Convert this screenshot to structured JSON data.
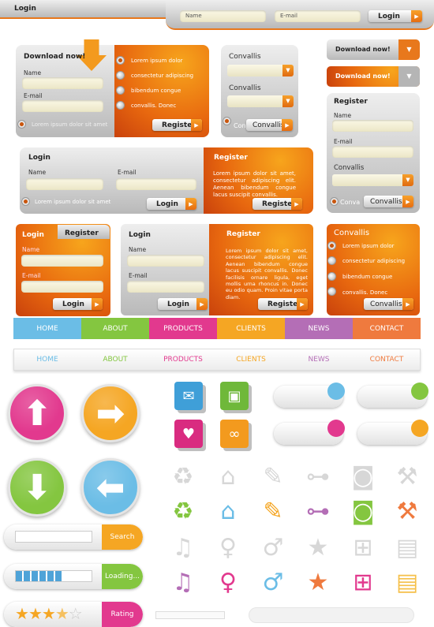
{
  "top_bar": {
    "title": "Login",
    "name_placeholder": "Name",
    "email_placeholder": "E-mail",
    "login_label": "Login"
  },
  "panel_download": {
    "title": "Download now!",
    "name_label": "Name",
    "email_label": "E-mail",
    "remember": "Lorem ipsum dolor sit amet",
    "options": [
      "Lorem   ipsum   dolor",
      "consectetur adipiscing",
      "bibendum  congue",
      "convallis.  Donec"
    ],
    "register_label": "Register"
  },
  "panel_convallis": {
    "label1": "Convallis",
    "label2": "Convallis",
    "radio_label": "Conva",
    "button_label": "Convallis"
  },
  "download_buttons": {
    "gray": "Download now!",
    "orange": "Download now!"
  },
  "panel_register_right": {
    "title": "Register",
    "name_label": "Name",
    "email_label": "E-mail",
    "select_label": "Convallis",
    "radio_label": "Conva",
    "button_label": "Convallis"
  },
  "panel_login_wide": {
    "title": "Login",
    "name_label": "Name",
    "email_label": "E-mail",
    "remember": "Lorem ipsum dolor sit amet",
    "login_label": "Login",
    "register_title": "Register",
    "register_text": "Lorem ipsum dolor sit amet, consectetur adipiscing elit. Aenean bibendum congue lacus suscipit convallis.",
    "register_label": "Register"
  },
  "panel_tabs": {
    "tab_login": "Login",
    "tab_register": "Register",
    "name_label": "Name",
    "email_label": "E-mail",
    "login_label": "Login"
  },
  "panel_login_register": {
    "title": "Login",
    "name_label": "Name",
    "email_label": "E-mail",
    "login_label": "Login",
    "register_title": "Register",
    "register_text": "Lorem ipsum dolor sit amet, consectetur adipiscing elit. Aenean bibendum congue lacus suscipit convallis. Donec facilisis ornare ligula, eget mollis urna rhoncus in. Donec eu odio quam. Proin vitae porta diam.",
    "register_label": "Register"
  },
  "panel_convallis_orange": {
    "title": "Convallis",
    "options": [
      "Lorem   ipsum   dolor",
      "consectetur adipiscing",
      "bibendum  congue",
      "convallis.  Donec"
    ],
    "button_label": "Convallis"
  },
  "nav_colored": {
    "items": [
      {
        "label": "HOME",
        "color": "#6bbde6"
      },
      {
        "label": "ABOUT",
        "color": "#84c640"
      },
      {
        "label": "PRODUCTS",
        "color": "#e2398e"
      },
      {
        "label": "CLIENTS",
        "color": "#f5a623"
      },
      {
        "label": "NEWS",
        "color": "#b46eb6"
      },
      {
        "label": "CONTACT",
        "color": "#ef7a3e"
      }
    ]
  },
  "nav_white": {
    "items": [
      {
        "label": "HOME",
        "color": "#6bbde6"
      },
      {
        "label": "ABOUT",
        "color": "#84c640"
      },
      {
        "label": "PRODUCTS",
        "color": "#e2398e"
      },
      {
        "label": "CLIENTS",
        "color": "#f5a623"
      },
      {
        "label": "NEWS",
        "color": "#b46eb6"
      },
      {
        "label": "CONTACT",
        "color": "#ef7a3e"
      }
    ]
  },
  "arrow_buttons": [
    {
      "icon": "arrow-up-icon",
      "glyph": "⬆",
      "color": "#e2398e"
    },
    {
      "icon": "arrow-right-icon",
      "glyph": "➡",
      "color": "#f5a623"
    },
    {
      "icon": "arrow-down-icon",
      "glyph": "⬇",
      "color": "#84c640"
    },
    {
      "icon": "arrow-left-icon",
      "glyph": "⬅",
      "color": "#6bbde6"
    }
  ],
  "cube_icons": [
    {
      "icon": "mail-icon",
      "glyph": "✉",
      "color": "#3f9fd8"
    },
    {
      "icon": "tv-icon",
      "glyph": "▣",
      "color": "#6fb83a"
    },
    {
      "icon": "heart-icon",
      "glyph": "♥",
      "color": "#d92b80"
    },
    {
      "icon": "link-icon",
      "glyph": "∞",
      "color": "#f39a1e"
    }
  ],
  "toggles": [
    {
      "knob": "#6bbde6",
      "state": "on"
    },
    {
      "knob": "#84c640",
      "state": "on"
    },
    {
      "knob": "#e2398e",
      "state": "on"
    },
    {
      "knob": "#f5a623",
      "state": "on"
    }
  ],
  "icon_grid": [
    {
      "icon": "recycle-icon",
      "glyph": "♻",
      "color": "#84c640"
    },
    {
      "icon": "house-icon",
      "glyph": "⌂",
      "color": "#6bbde6"
    },
    {
      "icon": "pencil-icon",
      "glyph": "✎",
      "color": "#f5a623"
    },
    {
      "icon": "gamepad-icon",
      "glyph": "⊶",
      "color": "#b46eb6"
    },
    {
      "icon": "camera-icon",
      "glyph": "◙",
      "color": "#84c640"
    },
    {
      "icon": "wrench-icon",
      "glyph": "⚒",
      "color": "#ef7a3e"
    },
    {
      "icon": "music-icon",
      "glyph": "♫",
      "color": "#b46eb6"
    },
    {
      "icon": "woman-icon",
      "glyph": "♀",
      "color": "#e2398e"
    },
    {
      "icon": "man-icon",
      "glyph": "♂",
      "color": "#6bbde6"
    },
    {
      "icon": "star-icon",
      "glyph": "★",
      "color": "#ef7a3e"
    },
    {
      "icon": "cart-icon",
      "glyph": "⊞",
      "color": "#e2398e"
    },
    {
      "icon": "film-icon",
      "glyph": "▤",
      "color": "#f5c04a"
    }
  ],
  "search_bar": {
    "button_label": "Search",
    "color": "#f5a623",
    "value": ""
  },
  "loading_bar": {
    "label": "Loading...",
    "color": "#84c640",
    "progress": 0.6
  },
  "rating_bar": {
    "label": "Rating",
    "color": "#e2398e",
    "rating": 3.5,
    "max": 5
  }
}
